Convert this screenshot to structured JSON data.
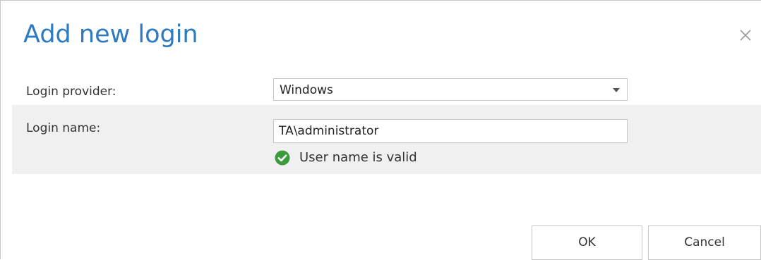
{
  "dialog": {
    "title": "Add new login",
    "close_icon": "close-icon"
  },
  "form": {
    "provider": {
      "label": "Login provider:",
      "selected": "Windows"
    },
    "login_name": {
      "label": "Login name:",
      "value": "TA\\administrator",
      "validation_message": "User name is valid",
      "validation_icon": "check-circle-icon"
    }
  },
  "buttons": {
    "ok_label": "OK",
    "cancel_label": "Cancel"
  },
  "colors": {
    "title": "#2e7ac0",
    "row_highlight": "#f0f0f0",
    "valid": "#3a9a3c"
  }
}
